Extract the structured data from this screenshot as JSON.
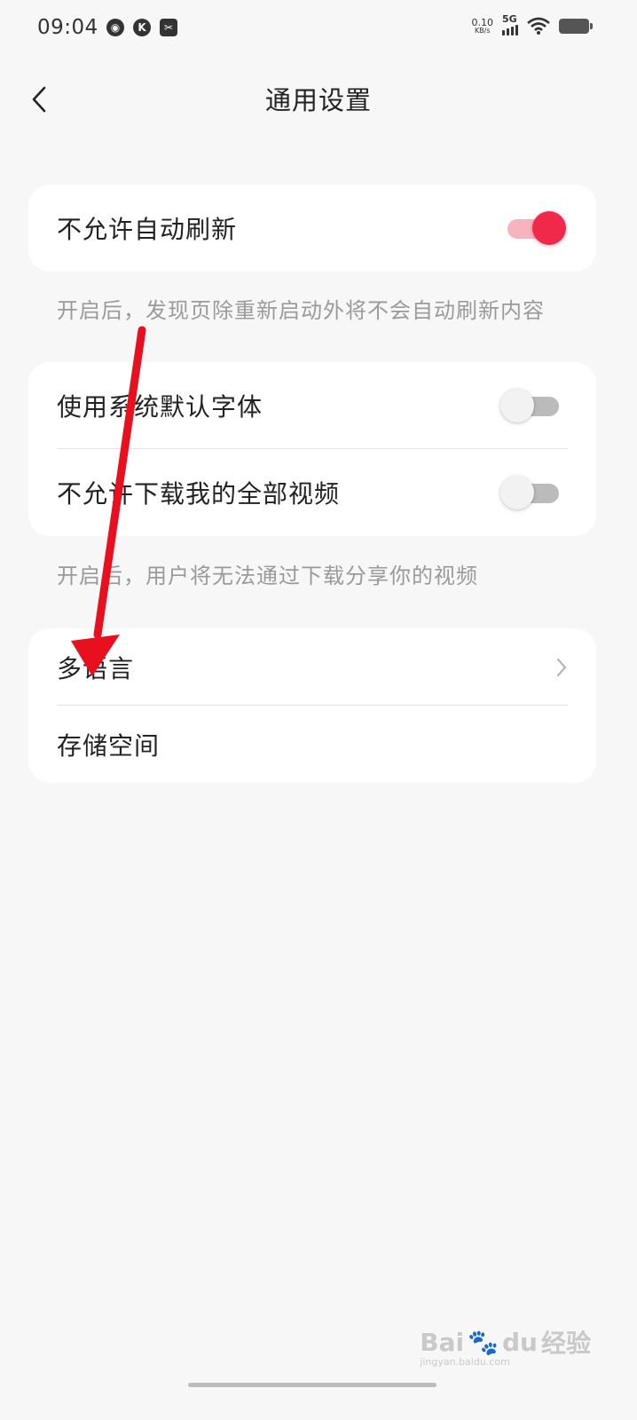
{
  "status_bar": {
    "time": "09:04",
    "left_icons": [
      "globe-icon",
      "k-app-icon",
      "scan-app-icon"
    ],
    "net_speed_value": "0.10",
    "net_speed_unit": "KB/s",
    "network": "5G",
    "wifi_icon": "wifi-icon",
    "battery_icon": "battery-icon"
  },
  "header": {
    "title": "通用设置",
    "back_icon": "chevron-left-icon"
  },
  "card1": {
    "rows": [
      {
        "label": "不允许自动刷新",
        "toggle": "on"
      }
    ]
  },
  "note1": "开启后，发现页除重新启动外将不会自动刷新内容",
  "card2": {
    "rows": [
      {
        "label": "使用系统默认字体",
        "toggle": "off"
      },
      {
        "label": "不允许下载我的全部视频",
        "toggle": "off"
      }
    ]
  },
  "note2": "开启后，用户将无法通过下载分享你的视频",
  "card3": {
    "rows": [
      {
        "label": "多语言",
        "icon": "chevron-right-icon"
      },
      {
        "label": "存储空间"
      }
    ]
  },
  "colors": {
    "accent": "#f0284a",
    "annotation_arrow": "#e8101e",
    "background": "#f7f7f7"
  },
  "watermark": {
    "brand": "Bai",
    "brand_tail": "du",
    "product": "经验",
    "url": "jingyan.baidu.com"
  }
}
